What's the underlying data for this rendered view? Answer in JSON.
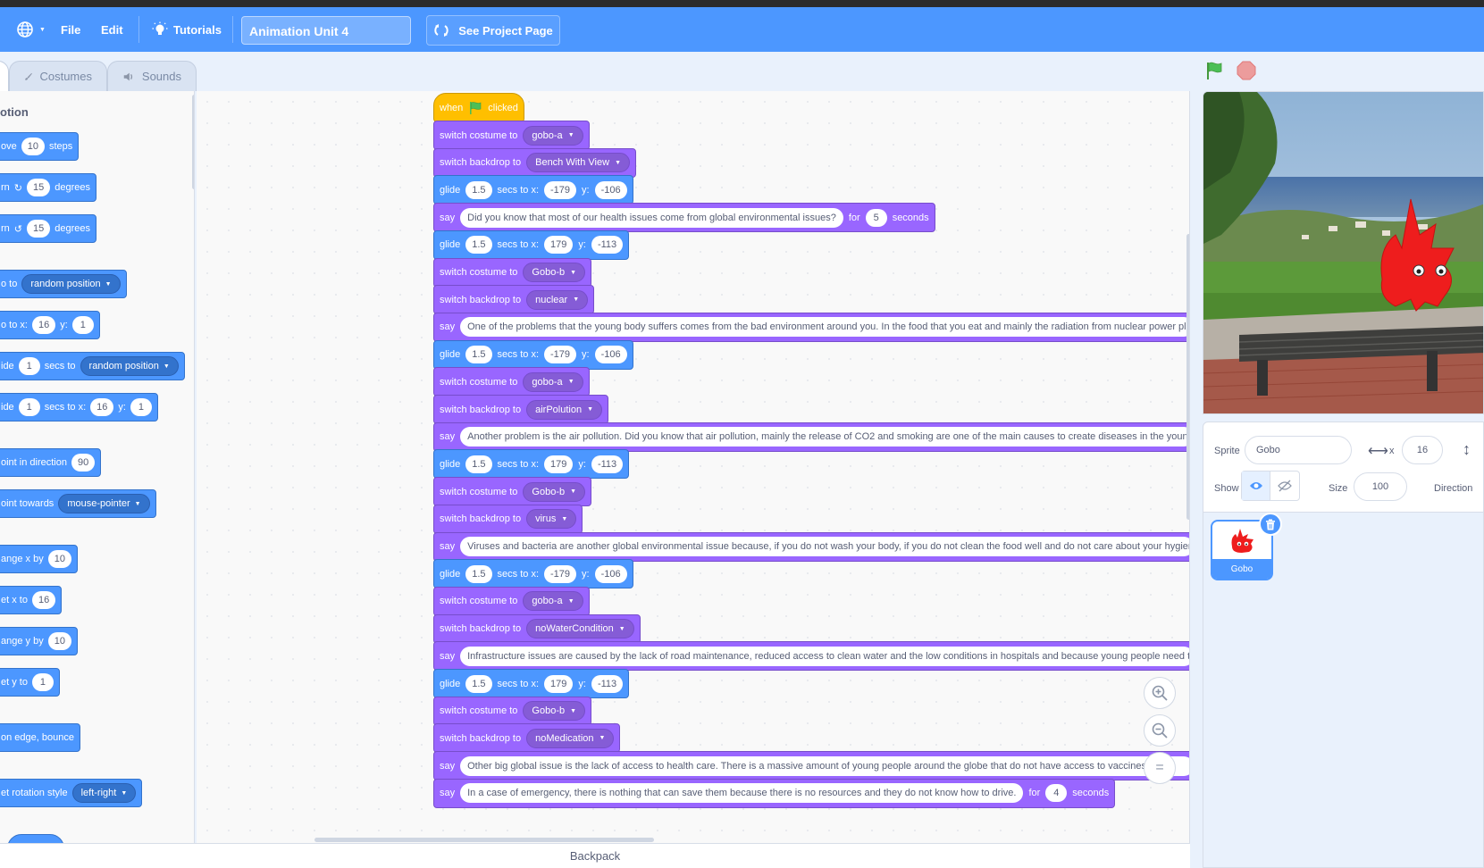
{
  "menubar": {
    "file": "File",
    "edit": "Edit",
    "tutorials": "Tutorials",
    "project_title": "Animation Unit 4",
    "see_project": "See Project Page"
  },
  "tabs": {
    "costumes": "Costumes",
    "sounds": "Sounds"
  },
  "palette": {
    "heading": "otion",
    "blocks": [
      {
        "pre": "ove",
        "v1": "10",
        "post": "steps"
      },
      {
        "pre": "rn",
        "v1": "15",
        "post": "degrees"
      },
      {
        "pre": "rn",
        "v1": "15",
        "post": "degrees"
      },
      {
        "pre": "o to",
        "dd": "random position"
      },
      {
        "pre": "o to x:",
        "v1": "16",
        "mid": "y:",
        "v2": "1"
      },
      {
        "pre": "ide",
        "v1": "1",
        "mid": "secs to",
        "dd": "random position"
      },
      {
        "pre": "ide",
        "v1": "1",
        "mid": "secs to x:",
        "v2": "16",
        "mid2": "y:",
        "v3": "1"
      },
      {
        "pre": "oint in direction",
        "v1": "90"
      },
      {
        "pre": "oint towards",
        "dd": "mouse-pointer"
      },
      {
        "pre": "ange x by",
        "v1": "10"
      },
      {
        "pre": "et x to",
        "v1": "16"
      },
      {
        "pre": "ange y by",
        "v1": "10"
      },
      {
        "pre": "et y to",
        "v1": "1"
      },
      {
        "pre": "on edge, bounce"
      },
      {
        "pre": "et rotation style",
        "dd": "left-right"
      }
    ]
  },
  "script": {
    "hat": {
      "when": "when",
      "clicked": "clicked"
    },
    "labels": {
      "switch_costume": "switch costume to",
      "switch_backdrop": "switch backdrop to",
      "glide": "glide",
      "secs_to_x": "secs to x:",
      "y": "y:",
      "say": "say",
      "for": "for",
      "seconds": "seconds"
    },
    "blocks": [
      {
        "type": "costume",
        "value": "gobo-a"
      },
      {
        "type": "backdrop",
        "value": "Bench With View"
      },
      {
        "type": "glide",
        "secs": "1.5",
        "x": "-179",
        "y": "-106"
      },
      {
        "type": "sayfor",
        "text": "Did you know that most of our health issues come from global environmental issues?",
        "secs": "5"
      },
      {
        "type": "glide",
        "secs": "1.5",
        "x": "179",
        "y": "-113"
      },
      {
        "type": "costume",
        "value": "Gobo-b"
      },
      {
        "type": "backdrop",
        "value": "nuclear"
      },
      {
        "type": "say",
        "text": "One of the problems that the young body suffers comes from the bad environment around you. In the food that you eat and mainly the radiation from nuclear power plant"
      },
      {
        "type": "glide",
        "secs": "1.5",
        "x": "-179",
        "y": "-106"
      },
      {
        "type": "costume",
        "value": "gobo-a"
      },
      {
        "type": "backdrop",
        "value": "airPolution"
      },
      {
        "type": "say",
        "text": "Another problem is the air pollution. Did you know that air pollution, mainly the release of CO2 and smoking are one of the main causes to create diseases in the young h"
      },
      {
        "type": "glide",
        "secs": "1.5",
        "x": "179",
        "y": "-113"
      },
      {
        "type": "costume",
        "value": "Gobo-b"
      },
      {
        "type": "backdrop",
        "value": "virus"
      },
      {
        "type": "say",
        "text": "Viruses and bacteria are another global environmental issue because, if you do not wash your body, if you do not clean the food well and do not care about your hygiene, y"
      },
      {
        "type": "glide",
        "secs": "1.5",
        "x": "-179",
        "y": "-106"
      },
      {
        "type": "costume",
        "value": "gobo-a"
      },
      {
        "type": "backdrop",
        "value": "noWaterCondition"
      },
      {
        "type": "say",
        "text": "Infrastructure issues are caused by the lack of road maintenance, reduced access to clean water and the low conditions in hospitals and because young people need thes"
      },
      {
        "type": "glide",
        "secs": "1.5",
        "x": "179",
        "y": "-113"
      },
      {
        "type": "costume",
        "value": "Gobo-b"
      },
      {
        "type": "backdrop",
        "value": "noMedication"
      },
      {
        "type": "say",
        "text": "Other big global issue is the lack of access to health care. There is a massive amount of young people around the globe that do not have access to vaccines, m"
      },
      {
        "type": "sayfor",
        "text": "In a case of emergency, there is nothing that can save them because there is no resources and they do not know how to drive.",
        "secs": "4"
      }
    ]
  },
  "zoom": {
    "in": "+",
    "out": "−",
    "reset": "="
  },
  "backpack": "Backpack",
  "sprite_info": {
    "sprite_label": "Sprite",
    "sprite_name": "Gobo",
    "x_label": "x",
    "x_value": "16",
    "show_label": "Show",
    "size_label": "Size",
    "size_value": "100",
    "direction_label": "Direction"
  },
  "sprites": [
    {
      "name": "Gobo"
    }
  ],
  "colors": {
    "motion": "#4c97ff",
    "looks": "#9966ff",
    "events": "#ffbf00",
    "menubar": "#4c97ff"
  }
}
